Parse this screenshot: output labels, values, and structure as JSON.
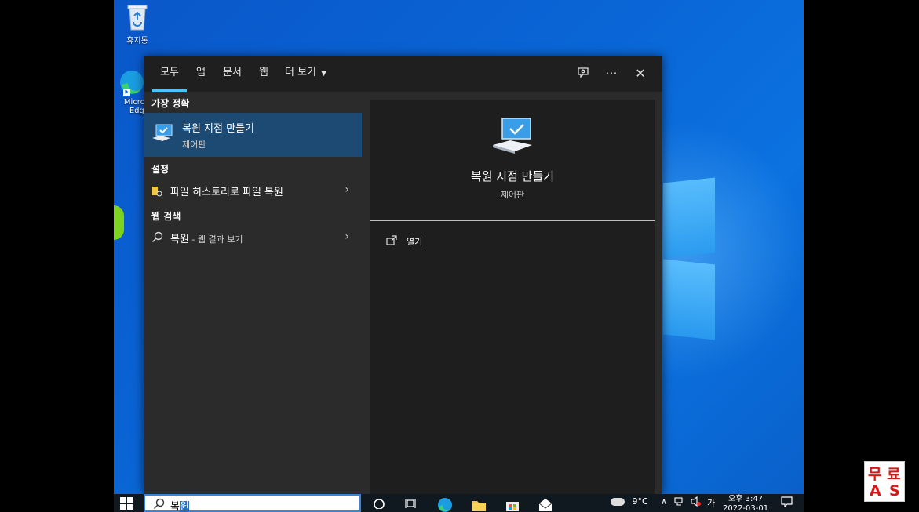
{
  "desktop": {
    "icons": [
      {
        "label": "휴지통"
      },
      {
        "label": "Micros Edge"
      }
    ]
  },
  "search": {
    "tabs": [
      {
        "label": "모두",
        "active": true
      },
      {
        "label": "앱"
      },
      {
        "label": "문서"
      },
      {
        "label": "웹"
      },
      {
        "label": "더 보기"
      }
    ],
    "toolbar_icons": [
      "feedback-icon",
      "more-icon",
      "close-icon"
    ],
    "more_glyph": "···",
    "close_glyph": "✕",
    "sections": {
      "best_match": "가장 정확",
      "settings": "설정",
      "web": "웹 검색"
    },
    "best_match": {
      "title": "복원 지점 만들기",
      "subtitle": "제어판"
    },
    "settings_item": {
      "label": "파일 히스토리로 파일 복원"
    },
    "web_item": {
      "label": "복원",
      "suffix": " - 웹 결과 보기"
    },
    "detail": {
      "title": "복원 지점 만들기",
      "subtitle": "제어판",
      "action_open": "열기"
    },
    "query_prefix": "복",
    "query_selected": "원"
  },
  "taskbar": {
    "weather": "9°C",
    "ime": "가",
    "time": "오후 3:47",
    "date": "2022-03-01"
  },
  "watermark": {
    "line1a": "무",
    "line1b": "료",
    "line2a": "A",
    "line2b": "S"
  },
  "colors": {
    "accent": "#4cc2ff",
    "selected_bg": "#1c4a72",
    "watermark_red": "#d61818"
  }
}
